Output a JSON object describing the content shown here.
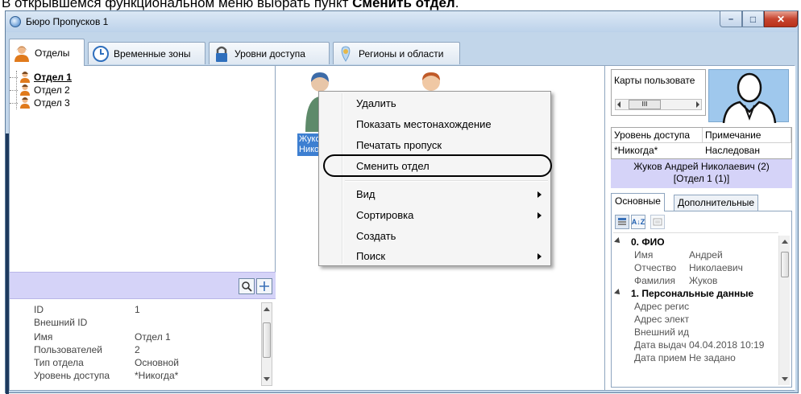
{
  "caption": {
    "prefix": "В открывшемся функциональном меню выбрать пункт ",
    "bold": "Сменить отдел",
    "suffix": "."
  },
  "window": {
    "title": "Бюро Пропусков 1",
    "min_symbol": "–",
    "max_symbol": "□",
    "close_symbol": "✕"
  },
  "tabs": [
    {
      "label": "Отделы",
      "icon": "person-icon"
    },
    {
      "label": "Временные зоны",
      "icon": "clock-icon"
    },
    {
      "label": "Уровни доступа",
      "icon": "lock-icon"
    },
    {
      "label": "Регионы и области",
      "icon": "region-icon"
    }
  ],
  "tree": {
    "items": [
      "Отдел 1",
      "Отдел 2",
      "Отдел 3"
    ],
    "selected": "Отдел 1"
  },
  "props": [
    {
      "key": "ID",
      "value": "1"
    },
    {
      "key": "Внешний ID",
      "value": ""
    },
    {
      "key": "Имя",
      "value": "Отдел 1"
    },
    {
      "key": "Пользователей",
      "value": "2"
    },
    {
      "key": "Тип отдела",
      "value": "Основной"
    },
    {
      "key": "Уровень доступа",
      "value": "*Никогда*"
    }
  ],
  "users": [
    {
      "name_line1": "Жуко",
      "name_line2": "Нико"
    }
  ],
  "context_menu": {
    "items": [
      {
        "label": "Удалить",
        "submenu": false
      },
      {
        "label": "Показать местонахождение",
        "submenu": false
      },
      {
        "label": "Печатать пропуск",
        "submenu": false
      },
      {
        "label": "Сменить отдел",
        "submenu": false,
        "highlighted": true
      },
      {
        "label": "Вид",
        "submenu": true
      },
      {
        "label": "Сортировка",
        "submenu": true
      },
      {
        "label": "Создать",
        "submenu": false
      },
      {
        "label": "Поиск",
        "submenu": true
      }
    ]
  },
  "right": {
    "cards_label": "Карты пользовате",
    "scroll_label": "III",
    "grid_headers": [
      "Уровень доступа",
      "Примечание"
    ],
    "grid_row": [
      "*Никогда*",
      "Наследован"
    ],
    "info_line1": "Жуков Андрей Николаевич (2)",
    "info_line2": "[Отдел 1 (1)]",
    "tabs": [
      "Основные",
      "Дополнительные"
    ],
    "sort_label": "A↓Z",
    "categories": [
      {
        "label": "0. ФИО",
        "rows": [
          {
            "key": "Имя",
            "value": "Андрей"
          },
          {
            "key": "Отчество",
            "value": "Николаевич"
          },
          {
            "key": "Фамилия",
            "value": "Жуков"
          }
        ]
      },
      {
        "label": "1. Персональные данные",
        "rows": [
          {
            "key": "Адрес регис",
            "value": ""
          },
          {
            "key": "Адрес элект",
            "value": ""
          },
          {
            "key": "Внешний ид",
            "value": ""
          },
          {
            "key": "Дата выдач",
            "value": "04.04.2018 10:19"
          },
          {
            "key": "Дата прием",
            "value": "Не задано"
          }
        ]
      }
    ]
  },
  "colors": {
    "selection": "#3d7fd1",
    "band": "#d5d3f8",
    "window_frame": "#c2d6ea"
  }
}
